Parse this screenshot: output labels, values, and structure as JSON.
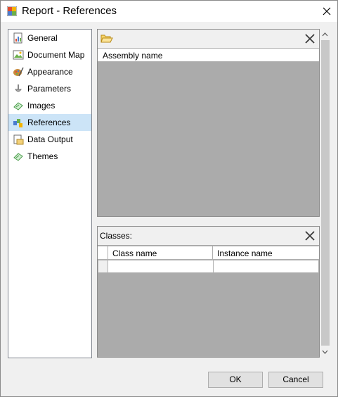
{
  "window": {
    "title": "Report - References"
  },
  "nav": {
    "items": [
      {
        "label": "General",
        "icon": "general-icon"
      },
      {
        "label": "Document Map",
        "icon": "document-map-icon"
      },
      {
        "label": "Appearance",
        "icon": "appearance-icon"
      },
      {
        "label": "Parameters",
        "icon": "parameters-icon"
      },
      {
        "label": "Images",
        "icon": "images-icon"
      },
      {
        "label": "References",
        "icon": "references-icon",
        "selected": true
      },
      {
        "label": "Data Output",
        "icon": "data-output-icon"
      },
      {
        "label": "Themes",
        "icon": "themes-icon"
      }
    ]
  },
  "assemblies": {
    "column_header": "Assembly name"
  },
  "classes": {
    "toolbar_label": "Classes:",
    "columns": [
      "Class name",
      "Instance name"
    ]
  },
  "buttons": {
    "ok": "OK",
    "cancel": "Cancel"
  },
  "colors": {
    "selection": "#cce4f7",
    "grid_bg": "#ababab",
    "window_bg": "#f0f0f0"
  }
}
